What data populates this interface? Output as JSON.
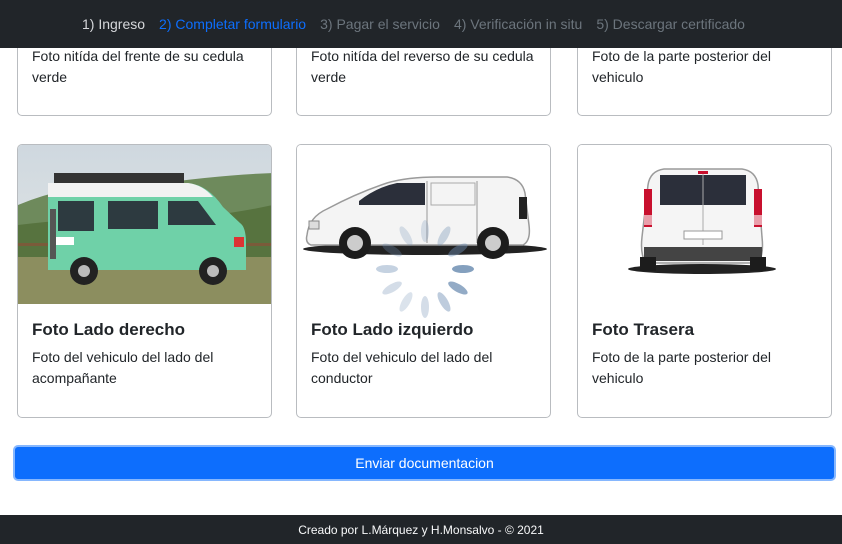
{
  "steps": [
    {
      "label": "1) Ingreso",
      "state": "done"
    },
    {
      "label": "2) Completar formulario",
      "state": "active"
    },
    {
      "label": "3) Pagar el servicio",
      "state": "pending"
    },
    {
      "label": "4) Verificación in situ",
      "state": "pending"
    },
    {
      "label": "5) Descargar certificado",
      "state": "pending"
    }
  ],
  "top_cards": [
    {
      "desc": "Foto nitída del frente de su cedula verde"
    },
    {
      "desc": "Foto nitída del reverso de su cedula verde"
    },
    {
      "desc": "Foto de la parte posterior del vehiculo"
    }
  ],
  "photo_cards": [
    {
      "title": "Foto Lado derecho",
      "desc": "Foto del vehiculo del lado del acompañante",
      "image": "green-camper-van-right-side"
    },
    {
      "title": "Foto Lado izquierdo",
      "desc": "Foto del vehiculo del lado del conductor",
      "image": "white-van-left-side"
    },
    {
      "title": "Foto Trasera",
      "desc": "Foto de la parte posterior del vehiculo",
      "image": "white-van-rear"
    }
  ],
  "submit_label": "Enviar documentacion",
  "footer_text": "Creado por L.Márquez y H.Monsalvo - © 2021",
  "colors": {
    "nav_bg": "#212529",
    "active_step": "#0d6efd",
    "button": "#0d6efd"
  }
}
